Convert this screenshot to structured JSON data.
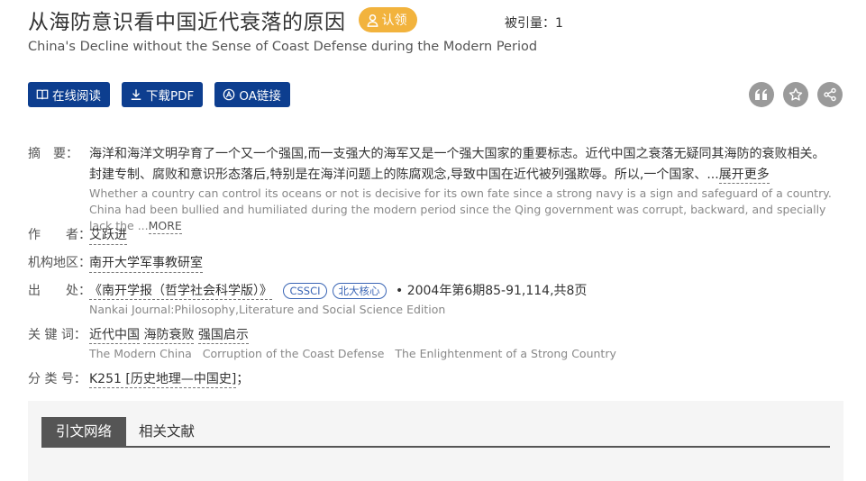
{
  "article": {
    "title": "从海防意识看中国近代衰落的原因",
    "claim_label": "认领",
    "cited_label": "被引量：",
    "cited_count": "1",
    "subtitle_en": "China's Decline without the Sense of Coast Defense during the Modern Period"
  },
  "actions": {
    "read_online": "在线阅读",
    "download_pdf": "下载PDF",
    "oa_link": "OA链接",
    "icons": [
      "quote-icon",
      "star-icon",
      "share-icon"
    ]
  },
  "abstract": {
    "label": "摘　要：",
    "cn": "海洋和海洋文明孕育了一个又一个强国,而一支强大的海军又是一个强大国家的重要标志。近代中国之衰落无疑同其海防的衰败相关。封建专制、腐败和意识形态落后,特别是在海洋问题上的陈腐观念,导致中国在近代被列强欺辱。所以,一个国家、...",
    "cn_more": "展开更多",
    "en": "Whether a country can control its oceans or not is decisive for its own fate since a strong navy is a sign and safeguard of a country. China had been bullied and humiliated during the modern period since the Qing government was corrupt, backward, and specially lack the ...",
    "en_more": "MORE"
  },
  "author": {
    "label": "作　　者：",
    "name": "艾跃进"
  },
  "institution": {
    "label": "机构地区：",
    "name": "南开大学军事教研室"
  },
  "source": {
    "label": "出　　处：",
    "journal": "《南开学报（哲学社会科学版）》",
    "badges": [
      "CSSCI",
      "北大核心"
    ],
    "bullet": "•",
    "issue": "2004年第6期85-91,114,共8页",
    "journal_en": "Nankai Journal:Philosophy,Literature and Social Science Edition"
  },
  "keywords": {
    "label": "关 键 词：",
    "cn": [
      "近代中国",
      "海防衰败",
      "强国启示"
    ],
    "en": [
      "The Modern China",
      "Corruption of the Coast Defense",
      "The Enlightenment of a Strong Country"
    ]
  },
  "classification": {
    "label": "分 类 号：",
    "code": "K251 [历史地理—中国史]",
    "sep": "；"
  },
  "tabs": [
    "引文网络",
    "相关文献"
  ],
  "colors": {
    "primary": "#0d3e8f",
    "claim": "#f2b33d",
    "icon_gray": "#9a9a9a"
  }
}
